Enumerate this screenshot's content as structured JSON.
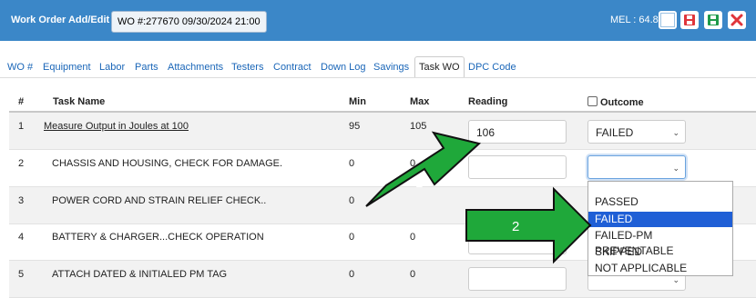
{
  "header": {
    "title": "Work Order Add/Edit",
    "wo_info": "WO #:277670 09/30/2024 21:00",
    "mel": "MEL : 64.8"
  },
  "tabs": [
    "WO #",
    "Equipment",
    "Labor",
    "Parts",
    "Attachments",
    "Testers",
    "Contract",
    "Down Log",
    "Savings",
    "Task WO",
    "DPC Code"
  ],
  "active_tab": "Task WO",
  "table": {
    "headers": {
      "num": "#",
      "task": "Task Name",
      "min": "Min",
      "max": "Max",
      "reading": "Reading",
      "outcome": "Outcome"
    },
    "rows": [
      {
        "num": "1",
        "task": "Measure Output in Joules at 100",
        "min": "95",
        "max": "105",
        "reading": "106",
        "outcome": "FAILED"
      },
      {
        "num": "2",
        "task": "CHASSIS AND HOUSING, CHECK FOR DAMAGE.",
        "min": "0",
        "max": "0",
        "reading": "",
        "outcome": ""
      },
      {
        "num": "3",
        "task": "POWER CORD AND STRAIN RELIEF CHECK..",
        "min": "0",
        "max": "",
        "reading": "",
        "outcome": ""
      },
      {
        "num": "4",
        "task": "BATTERY & CHARGER...CHECK OPERATION",
        "min": "0",
        "max": "0",
        "reading": "",
        "outcome": ""
      },
      {
        "num": "5",
        "task": "ATTACH DATED & INITIALED PM TAG",
        "min": "0",
        "max": "0",
        "reading": "",
        "outcome": ""
      }
    ]
  },
  "dropdown": {
    "options": [
      "PASSED",
      "FAILED",
      "FAILED-PM PREVENTABLE",
      "SKIPPED",
      "NOT APPLICABLE"
    ],
    "highlighted": "FAILED"
  },
  "annotations": {
    "arrow1": "1",
    "arrow2": "2"
  },
  "colors": {
    "header_bg": "#3b87c8",
    "link": "#1a66b8",
    "arrow_fill": "#1fa83a",
    "highlight": "#1f5fd6",
    "danger": "#e0353b",
    "save": "#1f9a4a"
  }
}
